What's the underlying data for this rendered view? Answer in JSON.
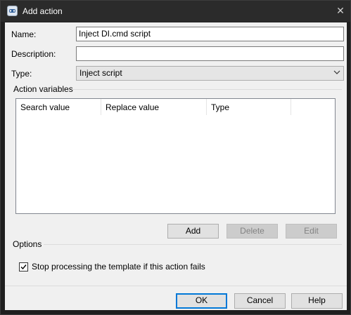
{
  "window": {
    "title": "Add action",
    "close_glyph": "✕"
  },
  "form": {
    "name_label": "Name:",
    "name_value": "Inject DI.cmd script",
    "description_label": "Description:",
    "description_value": "",
    "type_label": "Type:",
    "type_value": "Inject script"
  },
  "action_variables": {
    "group_label": "Action variables",
    "columns": [
      "Search value",
      "Replace value",
      "Type"
    ],
    "rows": [],
    "add_label": "Add",
    "delete_label": "Delete",
    "edit_label": "Edit"
  },
  "options": {
    "group_label": "Options",
    "stop_processing_label": "Stop processing the template if this action fails",
    "stop_processing_checked": true
  },
  "footer": {
    "ok_label": "OK",
    "cancel_label": "Cancel",
    "help_label": "Help"
  },
  "icons": {
    "app": "app-icon",
    "close": "close-icon",
    "dropdown": "chevron-down-icon",
    "check": "check-icon"
  },
  "colors": {
    "titlebar": "#2b2b2b",
    "dialog_bg": "#f0f0f0",
    "default_button_border": "#0078d7",
    "disabled_text": "#838383"
  }
}
